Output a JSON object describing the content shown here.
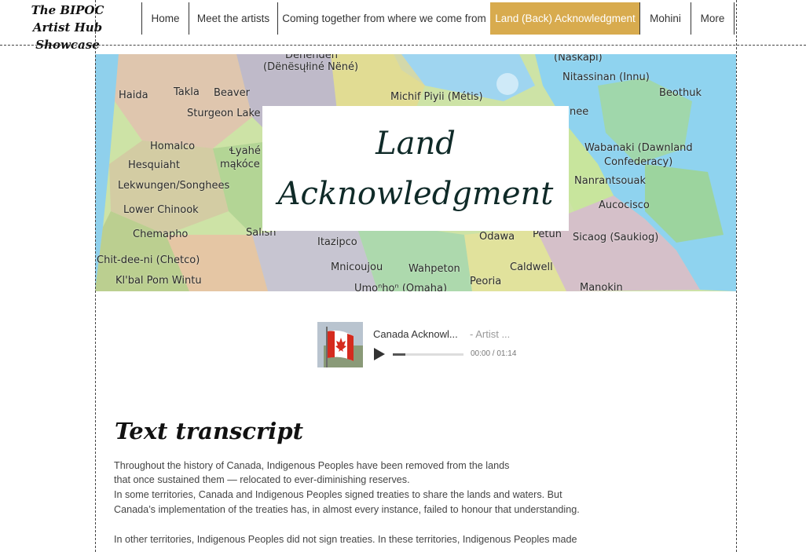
{
  "site": {
    "logo_line1": "The BIPOC",
    "logo_line2": "Artist Hub Showcase"
  },
  "nav": {
    "items": [
      {
        "label": "Home"
      },
      {
        "label": "Meet the artists"
      },
      {
        "label": "Coming together from where we come from"
      },
      {
        "label": "Land (Back) Acknowledgment",
        "active": true
      },
      {
        "label": "Mohini"
      },
      {
        "label": "More"
      }
    ],
    "active_color": "#d8ab4e"
  },
  "hero": {
    "title_line1": "Land",
    "title_line2": "Acknowledgment",
    "map_labels": [
      "Denendeh",
      "(Dënësųłiné Nëné)",
      "(Naskapi)",
      "Nitassinan (Innu)",
      "Haida",
      "Takla",
      "Beaver",
      "Michif Piyii (Métis)",
      "Beothuk",
      "Sturgeon Lake",
      "nee",
      "Homalco",
      "Ɬyahé",
      "Hesquiaht",
      "mąkóce",
      "Wabanaki (Dawnland",
      "Confederacy)",
      "Lekwungen/Songhees",
      "Nanrantsouak",
      "Lower Chinook",
      "Aucocisco",
      "Chemapho",
      "Salish",
      "Itazipco",
      "Odawa",
      "Petun",
      "Sicaog (Saukiog)",
      "Chit-dee-ni (Chetco)",
      "Mnicoujou",
      "Wahpeton",
      "Caldwell",
      "Kl'bal Pom Wintu",
      "Peoria",
      "Umoⁿhoⁿ (Omaha)",
      "Manokin"
    ]
  },
  "player": {
    "track_title": "Canada Acknowl...",
    "track_artist": "- Artist ...",
    "time": "00:00 / 01:14",
    "progress": 0.0,
    "cover_icon": "canada-flag-icon"
  },
  "transcript": {
    "heading": "Text transcript",
    "lines": [
      "Throughout the history of Canada, Indigenous Peoples have been removed from the lands",
      "that once sustained them — relocated to ever-diminishing reserves.",
      "In some territories, Canada and Indigenous Peoples signed treaties to share the lands and waters. But",
      "Canada’s implementation of the treaties has, in almost every instance, failed to honour that understanding.",
      "",
      "In other territories, Indigenous Peoples did not sign treaties. In these territories, Indigenous Peoples made"
    ]
  }
}
